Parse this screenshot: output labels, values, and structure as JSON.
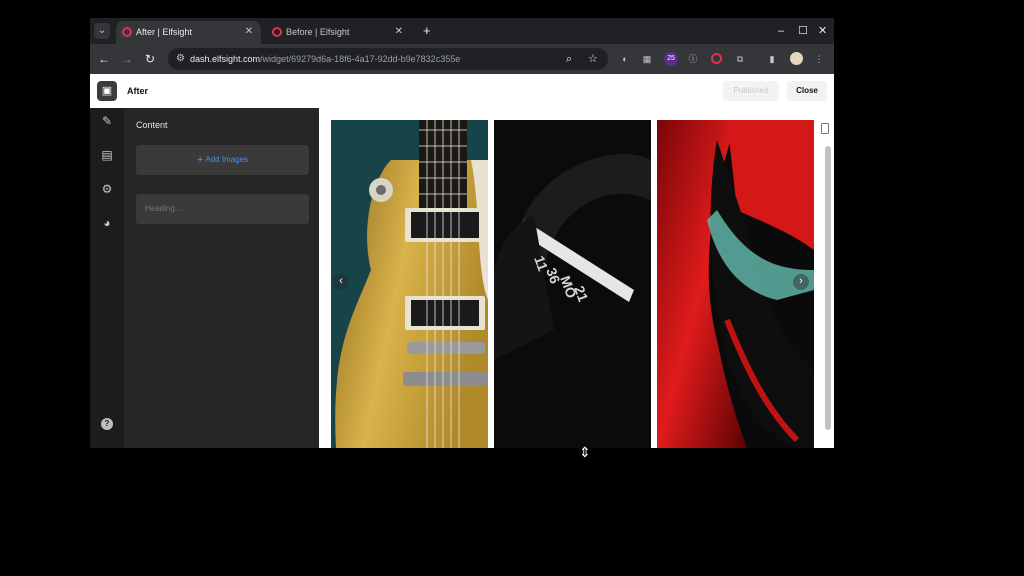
{
  "browser": {
    "tabs": [
      {
        "title": "After | Elfsight",
        "active": true
      },
      {
        "title": "Before | Elfsight",
        "active": false
      }
    ],
    "new_tab": "+",
    "url_domain": "dash.elfsight.com",
    "url_path": "/widget/69279d6a-18f6-4a17-92dd-b9e7832c355e",
    "extension_badge": "25"
  },
  "app": {
    "title": "After",
    "published_label": "Published",
    "close_label": "Close"
  },
  "sidebar": {
    "panel_title": "Content",
    "add_images_label": "Add Images",
    "heading_placeholder": "Heading..."
  },
  "gallery": {
    "images": [
      "guitar-photo",
      "smartwatch-photo",
      "red-car-photo"
    ]
  },
  "colors": {
    "accent_blue": "#4a8de8",
    "elfsight_red": "#e0324a"
  }
}
